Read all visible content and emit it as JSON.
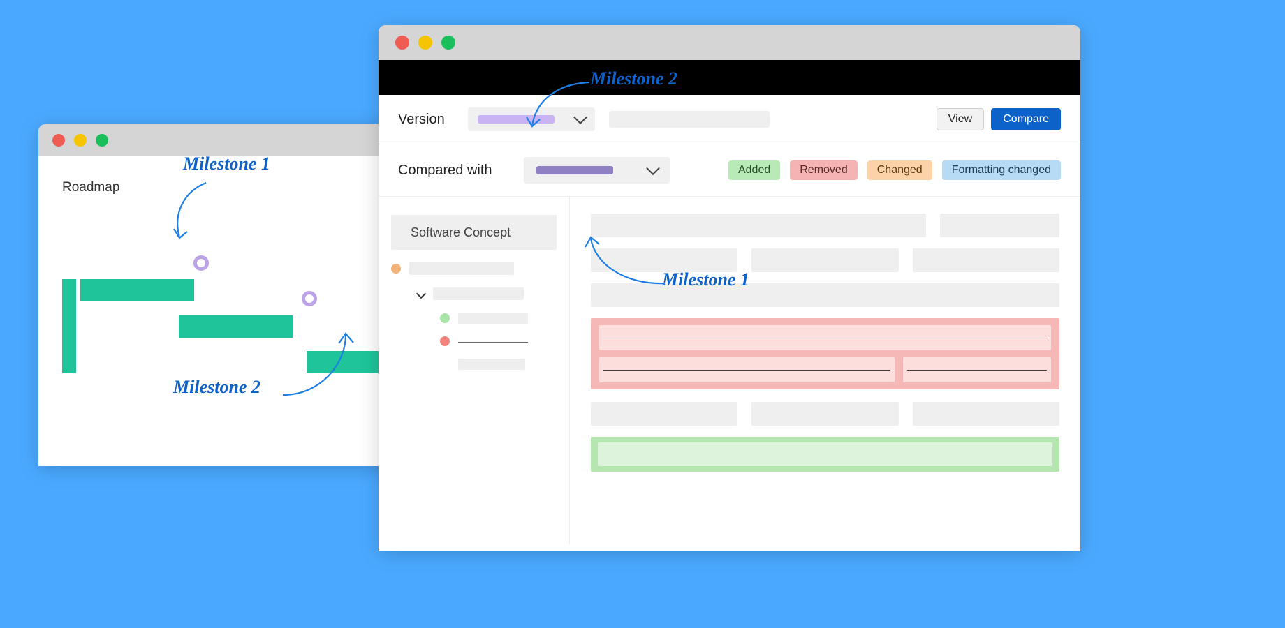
{
  "roadmap": {
    "title": "Roadmap",
    "annotations": {
      "m1": "Milestone 1",
      "m2": "Milestone 2"
    }
  },
  "compare": {
    "version_label": "Version",
    "compared_label": "Compared with",
    "view_label": "View",
    "compare_label": "Compare",
    "badges": {
      "added": "Added",
      "removed": "Removed",
      "changed": "Changed",
      "formatting": "Formatting changed"
    },
    "sidebar_header": "Software Concept",
    "annotations": {
      "top": "Milestone 2",
      "mid": "Milestone 1"
    },
    "colors": {
      "version_chip": "#c9b3f2",
      "compared_chip": "#8f80c3"
    }
  }
}
